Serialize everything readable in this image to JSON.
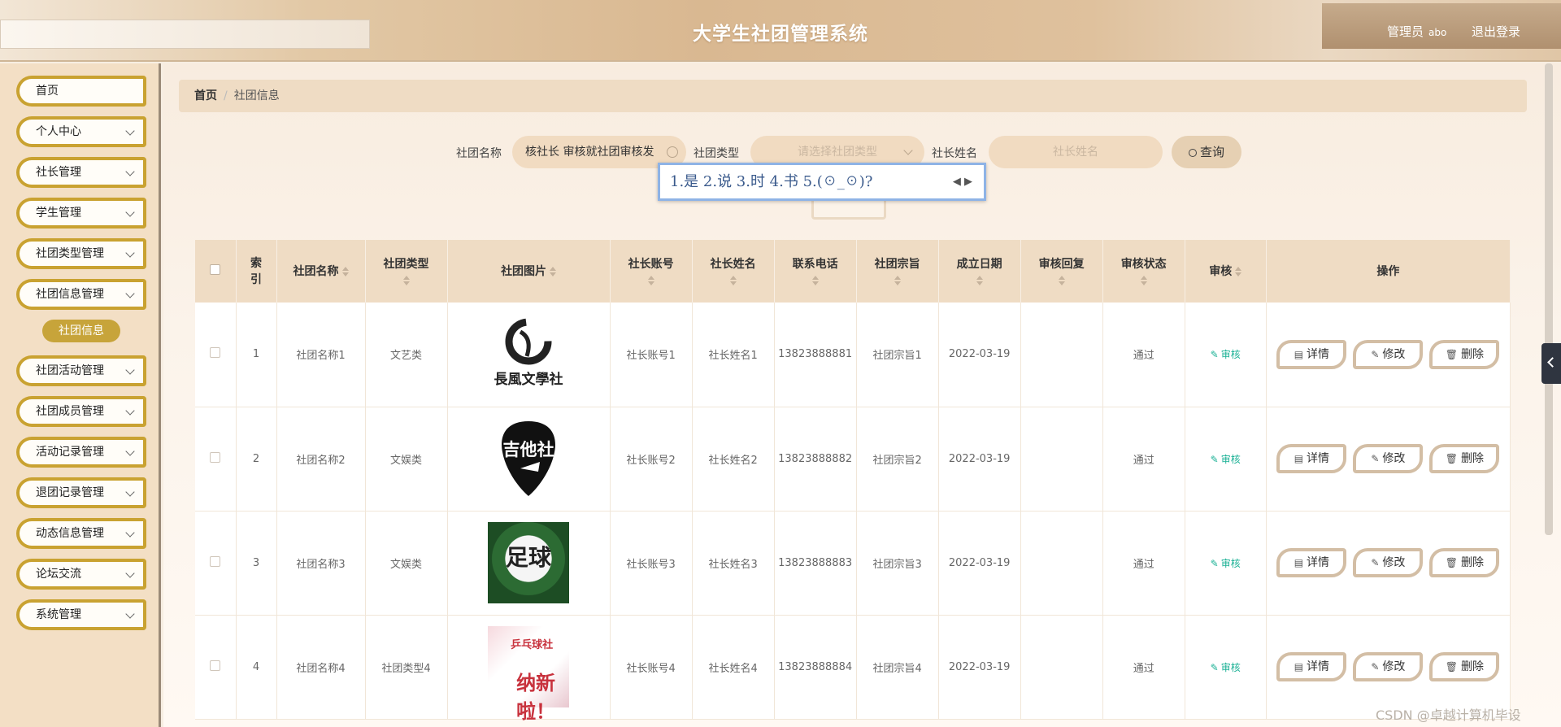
{
  "header": {
    "title": "大学生社团管理系统",
    "user_role": "管理员",
    "user_name": "abo",
    "logout": "退出登录"
  },
  "sidebar": {
    "items": [
      {
        "label": "首页"
      },
      {
        "label": "个人中心"
      },
      {
        "label": "社长管理"
      },
      {
        "label": "学生管理"
      },
      {
        "label": "社团类型管理"
      },
      {
        "label": "社团信息管理"
      },
      {
        "label": "社团活动管理"
      },
      {
        "label": "社团成员管理"
      },
      {
        "label": "活动记录管理"
      },
      {
        "label": "退团记录管理"
      },
      {
        "label": "动态信息管理"
      },
      {
        "label": "论坛交流"
      },
      {
        "label": "系统管理"
      }
    ],
    "active_sub": "社团信息"
  },
  "breadcrumb": {
    "home": "首页",
    "current": "社团信息"
  },
  "search": {
    "name_label": "社团名称",
    "name_value": "核社长 审核就社团审核发",
    "type_label": "社团类型",
    "type_placeholder": "请选择社团类型",
    "leader_label": "社长姓名",
    "leader_placeholder": "社长姓名",
    "query": "查询"
  },
  "ime": {
    "candidates": "1.是 2.说 3.时 4.书 5.(☉_☉)?"
  },
  "table": {
    "headers": [
      "索引",
      "社团名称",
      "社团类型",
      "社团图片",
      "社长账号",
      "社长姓名",
      "联系电话",
      "社团宗旨",
      "成立日期",
      "审核回复",
      "审核状态",
      "审核",
      "操作"
    ],
    "rows": [
      {
        "index": "1",
        "name": "社团名称1",
        "type": "文艺类",
        "account": "社长账号1",
        "leader": "社长姓名1",
        "phone": "13823888881",
        "purpose": "社团宗旨1",
        "date": "2022-03-19",
        "reply": "",
        "status": "通过"
      },
      {
        "index": "2",
        "name": "社团名称2",
        "type": "文娱类",
        "account": "社长账号2",
        "leader": "社长姓名2",
        "phone": "13823888882",
        "purpose": "社团宗旨2",
        "date": "2022-03-19",
        "reply": "",
        "status": "通过"
      },
      {
        "index": "3",
        "name": "社团名称3",
        "type": "文娱类",
        "account": "社长账号3",
        "leader": "社长姓名3",
        "phone": "13823888883",
        "purpose": "社团宗旨3",
        "date": "2022-03-19",
        "reply": "",
        "status": "通过"
      },
      {
        "index": "4",
        "name": "社团名称4",
        "type": "社团类型4",
        "account": "社长账号4",
        "leader": "社长姓名4",
        "phone": "13823888884",
        "purpose": "社团宗旨4",
        "date": "2022-03-19",
        "reply": "",
        "status": "通过"
      }
    ],
    "audit_label": "审核",
    "detail_label": "详情",
    "edit_label": "修改",
    "delete_label": "删除",
    "logo_texts": [
      "長風文學社",
      "吉他社",
      "足球",
      "乒乓球社",
      "纳新啦！"
    ]
  },
  "watermark": "CSDN @卓越计算机毕设",
  "colors": {
    "accent": "#c9a231",
    "header_bg": "#dfc19d",
    "audit_green": "#1bb195"
  }
}
